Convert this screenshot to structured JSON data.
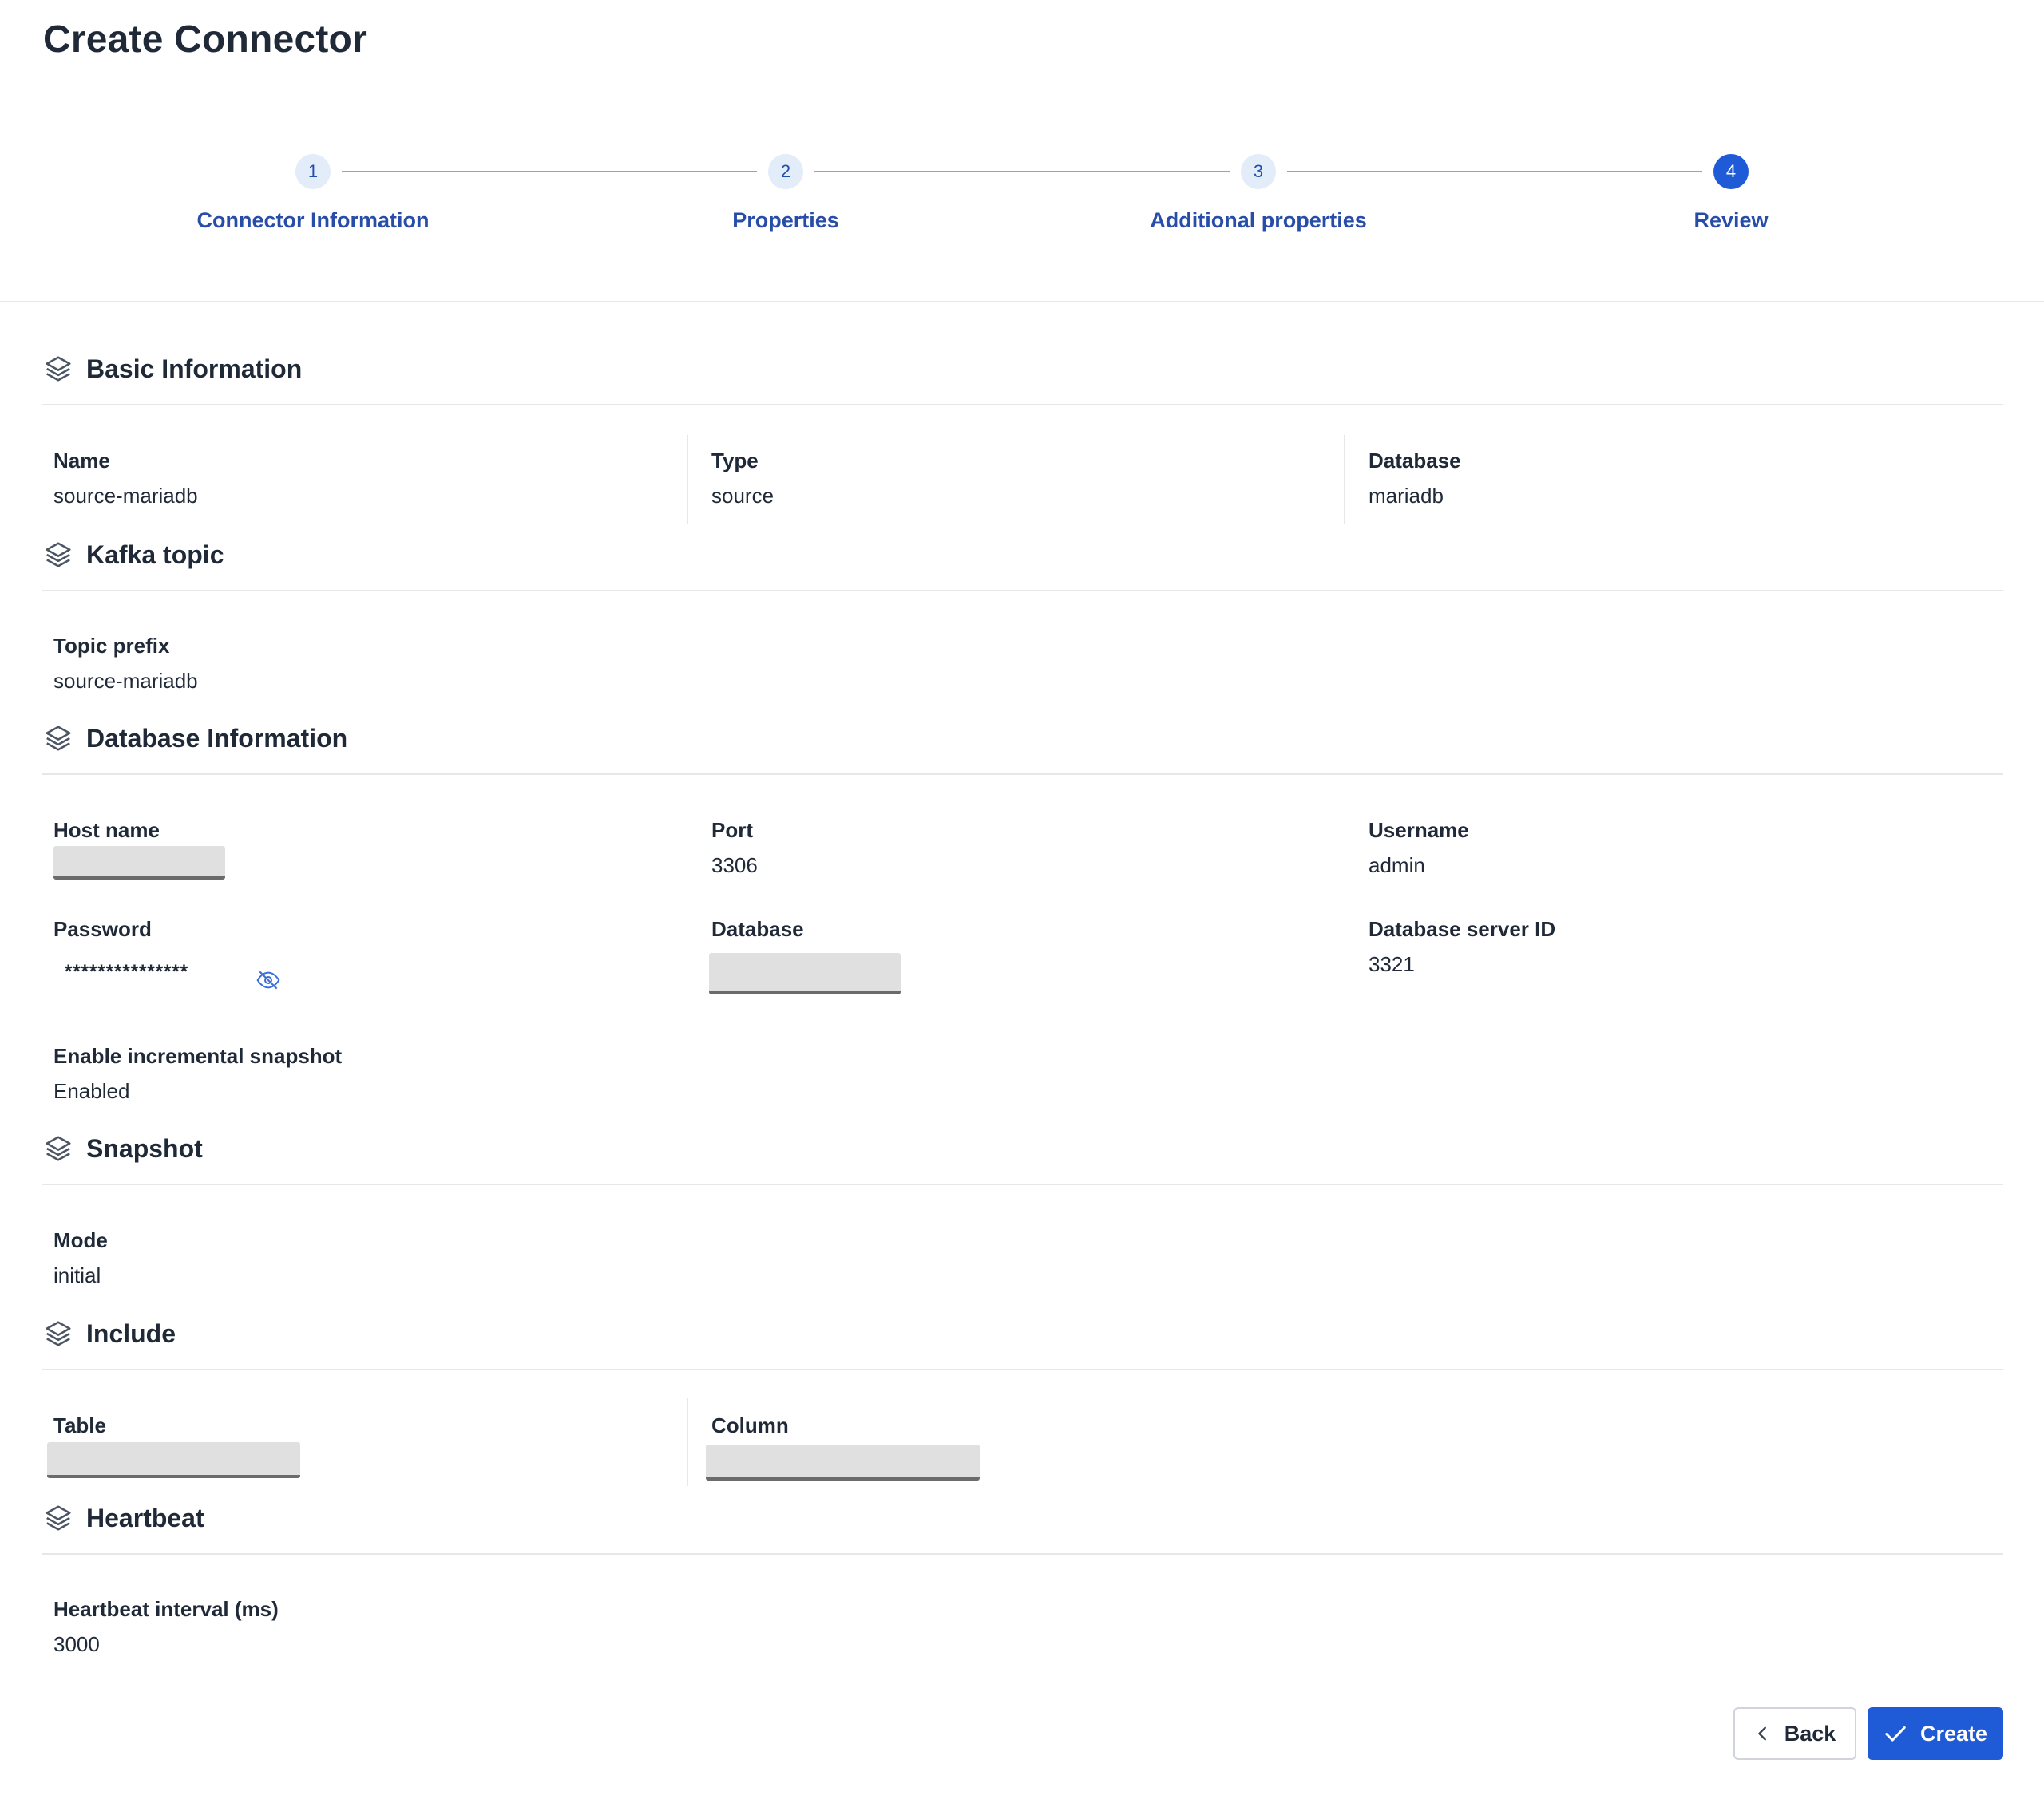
{
  "page": {
    "title": "Create Connector"
  },
  "stepper": {
    "steps": [
      {
        "number": "1",
        "label": "Connector Information"
      },
      {
        "number": "2",
        "label": "Properties"
      },
      {
        "number": "3",
        "label": "Additional properties"
      },
      {
        "number": "4",
        "label": "Review"
      }
    ],
    "active_step": 4
  },
  "sections": {
    "basic": {
      "title": "Basic Information",
      "name_label": "Name",
      "name_value": "source-mariadb",
      "type_label": "Type",
      "type_value": "source",
      "database_label": "Database",
      "database_value": "mariadb"
    },
    "kafka": {
      "title": "Kafka topic",
      "prefix_label": "Topic prefix",
      "prefix_value": "source-mariadb"
    },
    "dbinfo": {
      "title": "Database Information",
      "host_label": "Host name",
      "port_label": "Port",
      "port_value": "3306",
      "username_label": "Username",
      "username_value": "admin",
      "password_label": "Password",
      "password_value": "***************",
      "database_label": "Database",
      "server_id_label": "Database server ID",
      "server_id_value": "3321",
      "snapshot_label": "Enable incremental snapshot",
      "snapshot_value": "Enabled"
    },
    "snapshot": {
      "title": "Snapshot",
      "mode_label": "Mode",
      "mode_value": "initial"
    },
    "include": {
      "title": "Include",
      "table_label": "Table",
      "column_label": "Column"
    },
    "heartbeat": {
      "title": "Heartbeat",
      "interval_label": "Heartbeat interval (ms)",
      "interval_value": "3000"
    }
  },
  "buttons": {
    "back_label": "Back",
    "create_label": "Create"
  },
  "colors": {
    "primary": "#1f5ad7",
    "step_inactive_bg": "#e3ecf9",
    "link_text": "#274da8",
    "divider": "#e5e7eb"
  },
  "icons": {
    "section": "layers-icon",
    "password_toggle": "eye-slash-icon",
    "back": "chevron-left-icon",
    "create": "check-icon"
  }
}
